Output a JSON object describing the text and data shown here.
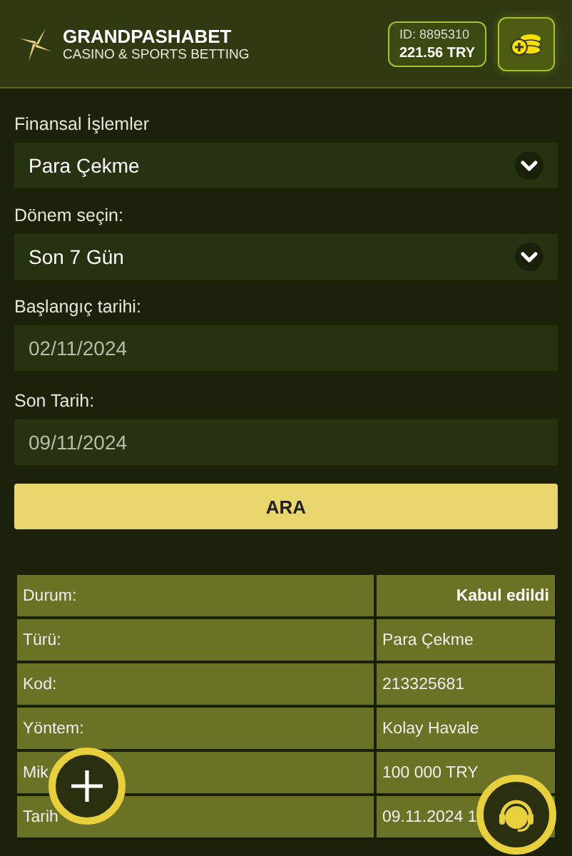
{
  "header": {
    "brand": "GRANDPASHABET",
    "tagline": "CASINO & SPORTS BETTING",
    "account_id": "ID: 8895310",
    "balance": "221.56 TRY"
  },
  "form": {
    "fields": [
      {
        "kind": "select",
        "label": "Finansal İşlemler",
        "value": "Para Çekme"
      },
      {
        "kind": "select",
        "label": "Dönem seçin:",
        "value": "Son 7 Gün"
      },
      {
        "kind": "date",
        "label": "Başlangıç tarihi:",
        "placeholder": "02/11/2024"
      },
      {
        "kind": "date",
        "label": "Son Tarih:",
        "placeholder": "09/11/2024"
      }
    ],
    "search_button": "ARA"
  },
  "details": {
    "rows": [
      {
        "label": "Durum:",
        "value": "Kabul edildi",
        "kind": "status"
      },
      {
        "label": "Türü:",
        "value": "Para Çekme",
        "kind": "plain"
      },
      {
        "label": "Kod:",
        "value": "213325681",
        "kind": "plain"
      },
      {
        "label": "Yöntem:",
        "value": "Kolay Havale",
        "kind": "plain"
      },
      {
        "label": "Mik",
        "value": "100 000 TRY",
        "kind": "plain"
      },
      {
        "label": "Tarih",
        "value": "09.11.2024 1",
        "kind": "plain"
      }
    ]
  }
}
